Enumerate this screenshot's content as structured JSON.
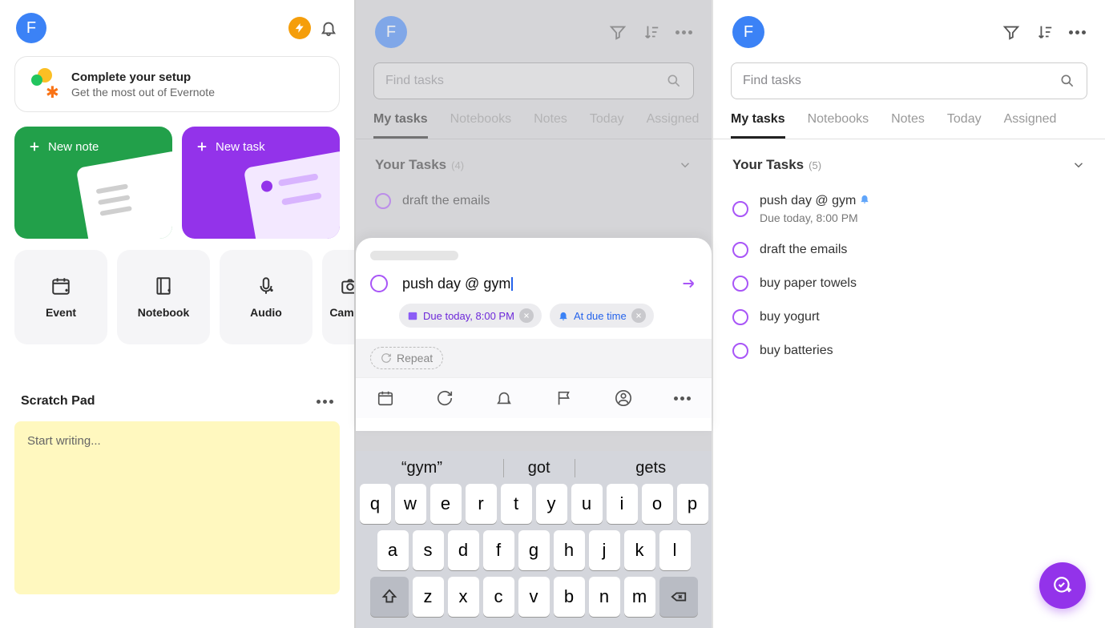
{
  "avatar_letter": "F",
  "p1": {
    "banner_title": "Complete your setup",
    "banner_sub": "Get the most out of Evernote",
    "new_note": "New note",
    "new_task": "New task",
    "quick": {
      "event": "Event",
      "notebook": "Notebook",
      "audio": "Audio",
      "camera": "Camera"
    },
    "scratch_title": "Scratch Pad",
    "scratch_placeholder": "Start writing..."
  },
  "p2": {
    "search_placeholder": "Find tasks",
    "tabs": {
      "my": "My tasks",
      "nb": "Notebooks",
      "notes": "Notes",
      "today": "Today",
      "assigned": "Assigned"
    },
    "group": "Your Tasks",
    "group_count": "(4)",
    "visible_task": "draft the emails",
    "compose_title": "push day @ gym",
    "due_chip": "Due today, 8:00 PM",
    "remind_chip": "At due time",
    "repeat": "Repeat",
    "suggestions": [
      "“gym”",
      "got",
      "gets"
    ],
    "kb": {
      "r1": [
        "q",
        "w",
        "e",
        "r",
        "t",
        "y",
        "u",
        "i",
        "o",
        "p"
      ],
      "r2": [
        "a",
        "s",
        "d",
        "f",
        "g",
        "h",
        "j",
        "k",
        "l"
      ],
      "r3": [
        "z",
        "x",
        "c",
        "v",
        "b",
        "n",
        "m"
      ]
    }
  },
  "p3": {
    "search_placeholder": "Find tasks",
    "tabs": {
      "my": "My tasks",
      "nb": "Notebooks",
      "notes": "Notes",
      "today": "Today",
      "assigned": "Assigned"
    },
    "group": "Your Tasks",
    "group_count": "(5)",
    "tasks": [
      {
        "title": "push day @ gym",
        "due": "Due today, 8:00 PM",
        "bell": true
      },
      {
        "title": "draft the emails"
      },
      {
        "title": "buy paper towels"
      },
      {
        "title": "buy yogurt"
      },
      {
        "title": "buy batteries"
      }
    ]
  }
}
